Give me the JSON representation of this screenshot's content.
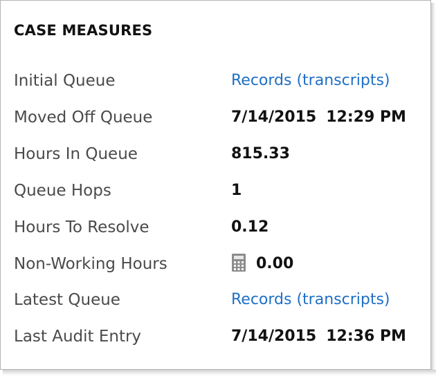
{
  "section": {
    "title": "CASE MEASURES"
  },
  "fields": [
    {
      "label": "Initial Queue",
      "value": "Records (transcripts)",
      "type": "link"
    },
    {
      "label": "Moved Off Queue",
      "date": "7/14/2015",
      "time": "12:29 PM",
      "type": "datetime"
    },
    {
      "label": "Hours In Queue",
      "value": "815.33",
      "type": "text"
    },
    {
      "label": "Queue Hops",
      "value": "1",
      "type": "text"
    },
    {
      "label": "Hours To Resolve",
      "value": "0.12",
      "type": "text"
    },
    {
      "label": "Non-Working Hours",
      "value": "0.00",
      "type": "calculated",
      "icon": "calculator-icon"
    },
    {
      "label": "Latest Queue",
      "value": "Records (transcripts)",
      "type": "link"
    },
    {
      "label": "Last Audit Entry",
      "date": "7/14/2015",
      "time": "12:36 PM",
      "type": "datetime"
    }
  ],
  "colors": {
    "link": "#1f6fc4",
    "label": "#4a4a4a",
    "value": "#111111"
  }
}
